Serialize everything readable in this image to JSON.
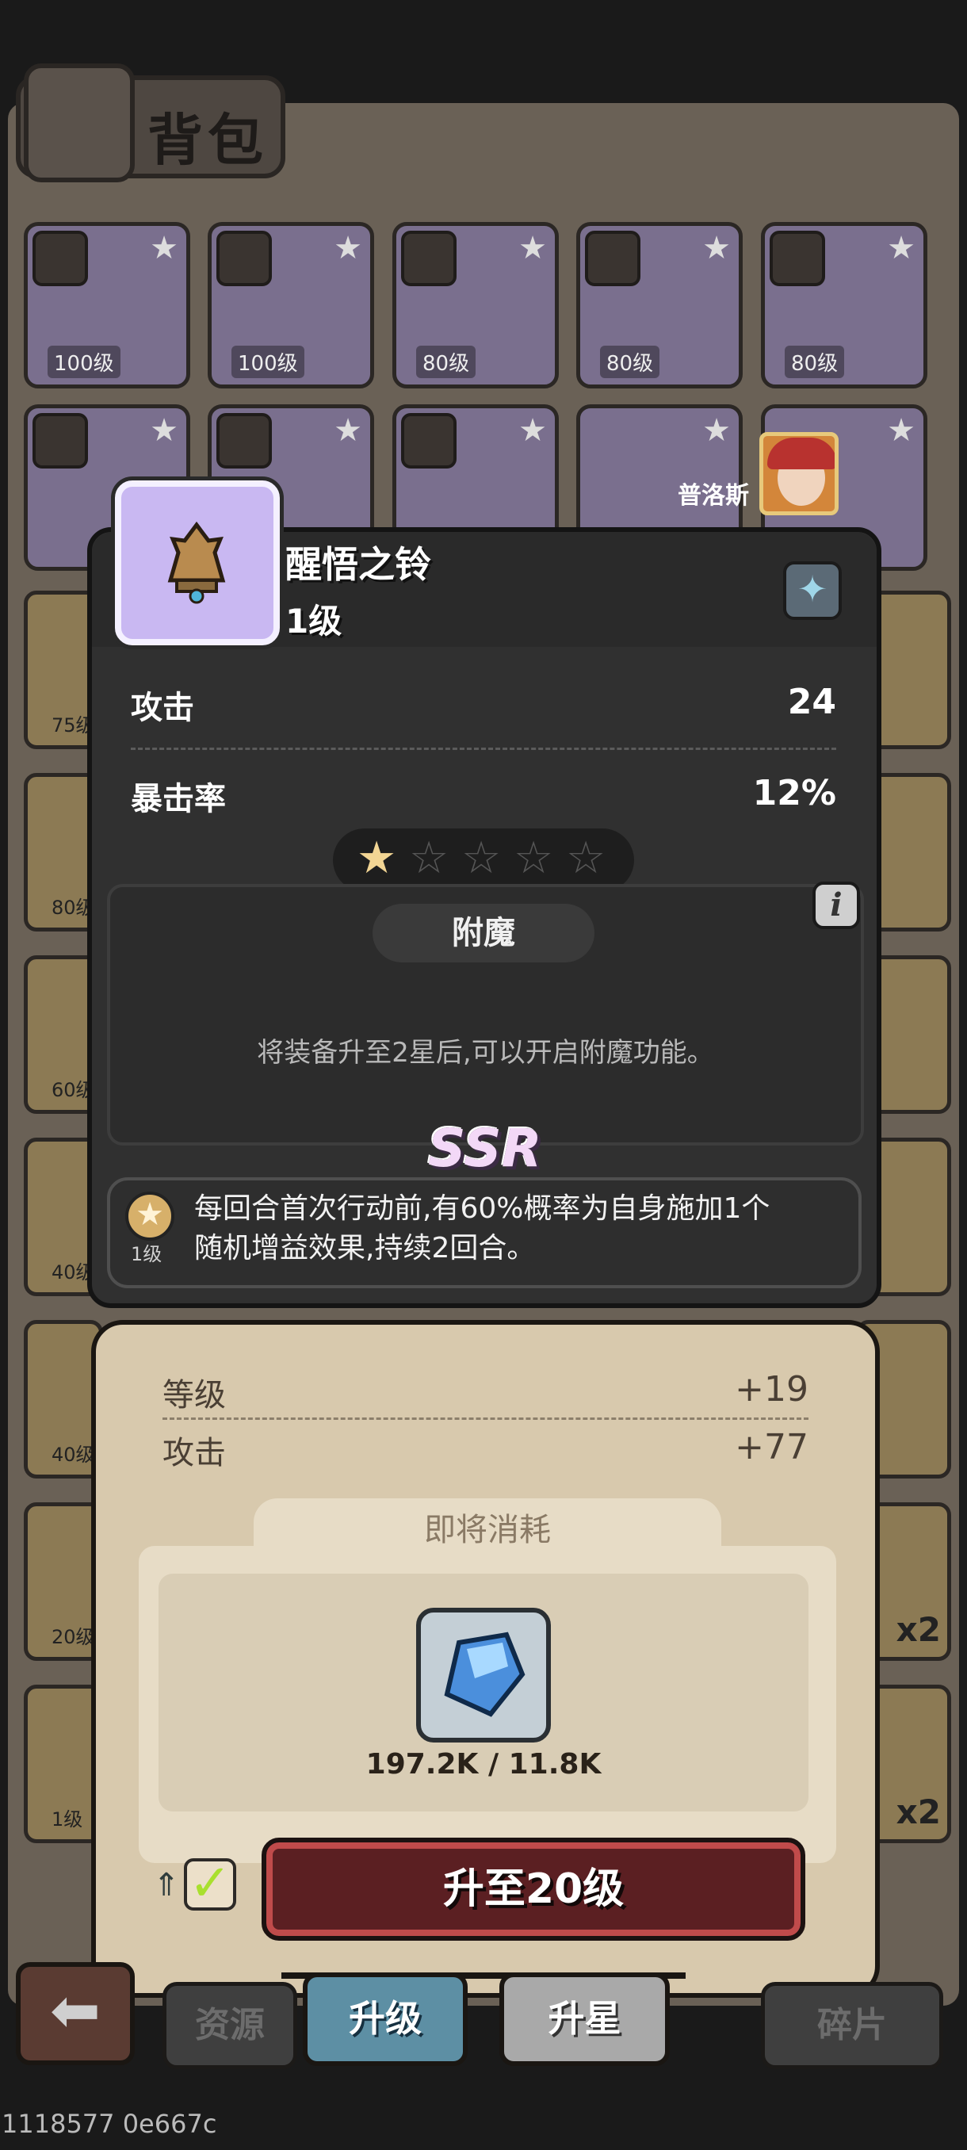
{
  "bag": {
    "title": "背包",
    "top_row_levels": [
      "100级",
      "100级",
      "80级",
      "80级",
      "80级"
    ],
    "side_levels": [
      "75级",
      "80级",
      "60级",
      "40级",
      "40级",
      "20级",
      "1级"
    ],
    "right_badges": [
      "x2",
      "x2"
    ]
  },
  "hero": {
    "name": "普洛斯"
  },
  "item": {
    "name": "醒悟之铃",
    "level": "1级",
    "stats": [
      {
        "label": "攻击",
        "value": "24"
      },
      {
        "label": "暴击率",
        "value": "12%"
      }
    ],
    "stars_filled": 1,
    "stars_total": 5,
    "enchant": {
      "title": "附魔",
      "info_icon": "i",
      "locked_text": "将装备升至2星后,可以开启附魔功能。"
    },
    "rarity": "SSR",
    "skill": {
      "level": "1级",
      "text_line1": "每回合首次行动前,有60%概率为自身施加1个",
      "text_line2": "随机增益效果,持续2回合。"
    }
  },
  "upgrade": {
    "rows": [
      {
        "label": "等级",
        "value": "+19"
      },
      {
        "label": "攻击",
        "value": "+77"
      }
    ],
    "consume_title": "即将消耗",
    "consume_count": "197.2K / 11.8K",
    "button_label": "升至20级",
    "auto_checked": true
  },
  "tabs": {
    "resources": "资源",
    "upgrade": "升级",
    "star_up": "升星",
    "fragments": "碎片"
  },
  "footer": "1118577 0e667c",
  "colors": {
    "accent_red": "#c04b4b",
    "tab_active": "#5d8fa4",
    "panel_light": "#d8c9ad",
    "panel_dark": "#303030"
  }
}
